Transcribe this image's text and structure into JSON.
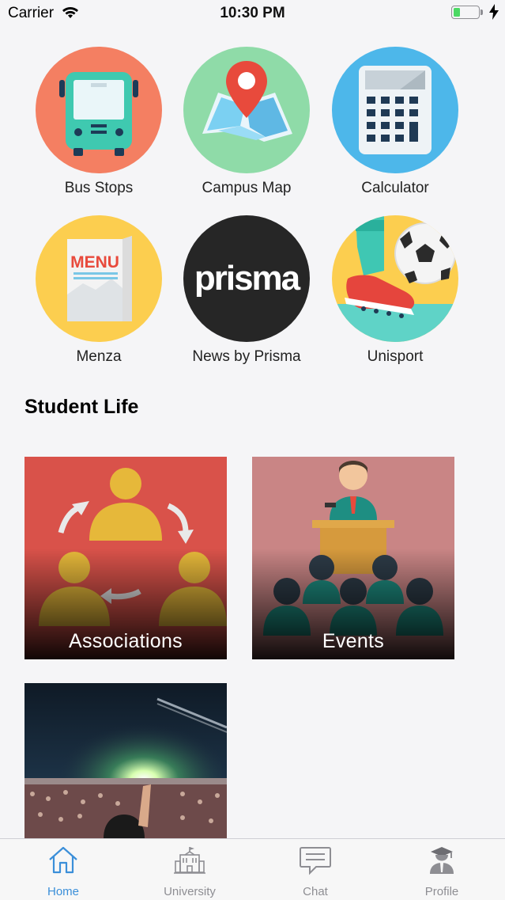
{
  "status_bar": {
    "carrier": "Carrier",
    "time": "10:30 PM"
  },
  "apps": [
    {
      "label": "Bus Stops",
      "icon": "bus-icon",
      "color": "#f47f62"
    },
    {
      "label": "Campus Map",
      "icon": "map-icon",
      "color": "#8fdba8"
    },
    {
      "label": "Calculator",
      "icon": "calculator-icon",
      "color": "#4db7ea"
    },
    {
      "label": "Menza",
      "icon": "menu-icon",
      "color": "#fcce4f"
    },
    {
      "label": "News by Prisma",
      "icon": "prisma-logo",
      "color": "#262626",
      "logo_text": "prisma"
    },
    {
      "label": "Unisport",
      "icon": "football-icon",
      "color": "#fcce4f"
    }
  ],
  "menu_icon_text": "MENU",
  "section_title": "Student Life",
  "cards": [
    {
      "label": "Associations",
      "color": "#d9524a"
    },
    {
      "label": "Events",
      "color": "#c98585"
    },
    {
      "label": "",
      "color": "#1f2d3d"
    }
  ],
  "tabs": [
    {
      "label": "Home",
      "icon": "home-icon",
      "active": true
    },
    {
      "label": "University",
      "icon": "university-icon",
      "active": false
    },
    {
      "label": "Chat",
      "icon": "chat-icon",
      "active": false
    },
    {
      "label": "Profile",
      "icon": "profile-icon",
      "active": false
    }
  ],
  "colors": {
    "accent": "#3b8fd9",
    "inactive": "#8e8e93",
    "background": "#f5f5f7"
  }
}
